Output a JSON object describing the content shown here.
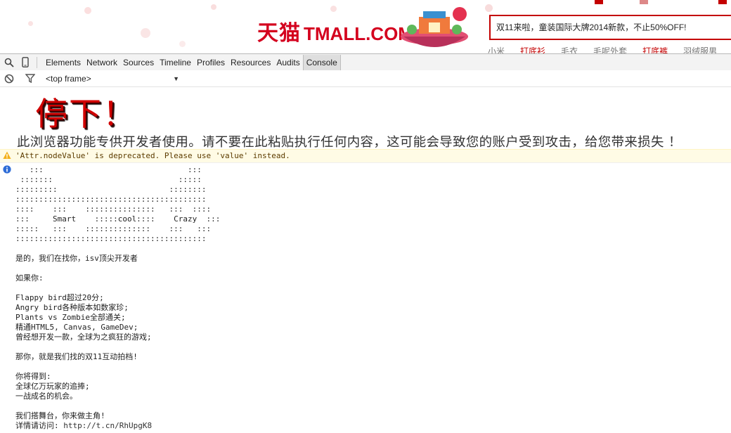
{
  "site": {
    "logo_cn": "天猫",
    "logo_en": "TMALL.COM",
    "search_value": "双11来啦，童装国际大牌2014新款，不止50%OFF!",
    "hot_words": [
      "小米",
      "打底衫",
      "毛衣",
      "毛呢外套",
      "打底裤",
      "羽绒服男"
    ],
    "hot_red": [
      1,
      4
    ],
    "accent_color": "#c40000"
  },
  "devtools": {
    "tabs": [
      "Elements",
      "Network",
      "Sources",
      "Timeline",
      "Profiles",
      "Resources",
      "Audits",
      "Console"
    ],
    "active_tab": "Console",
    "icons": [
      "search-icon",
      "device-mode-icon"
    ],
    "frame": "<top frame>"
  },
  "console": {
    "stop_title": "停下！",
    "warning_banner": "此浏览器功能专供开发者使用。请不要在此粘贴执行任何内容，这可能会导致您的账户受到攻击，给您带来损失 ！",
    "deprecation_warning": "'Attr.nodeValue' is deprecated. Please use 'value' instead.",
    "ascii_art": [
      "   :::                               :::",
      " :::::::                           :::::",
      ":::::::::                        ::::::::",
      ":::::::::::::::::::::::::::::::::::::::::",
      "::::    :::    :::::::::::::::   :::  ::::",
      ":::     Smart    :::::cool::::    Crazy  :::",
      ":::::   :::    ::::::::::::::    :::   :::",
      ":::::::::::::::::::::::::::::::::::::::::"
    ],
    "lines": [
      "是的，我们在找你，isv顶尖开发者",
      "",
      "如果你:",
      "",
      "Flappy bird超过20分;",
      "Angry bird各种版本如数家珍;",
      "Plants vs Zombie全部通关;",
      "精通HTML5, Canvas, GameDev;",
      "曾经想开发一款，全球为之疯狂的游戏;",
      "",
      "那你，就是我们找的双11互动拍档!",
      "",
      "你将得到:",
      "全球亿万玩家的追捧;",
      "一战成名的机会。",
      "",
      "我们搭舞台，你来做主角!"
    ],
    "link_prefix": "详情请访问: ",
    "link_url": "http://t.cn/RhUpgK8"
  }
}
